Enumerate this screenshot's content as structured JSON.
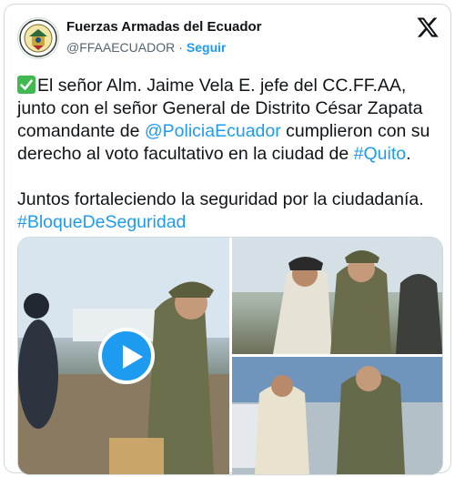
{
  "author": {
    "name": "Fuerzas Armadas del Ecuador",
    "handle": "@FFAAECUADOR",
    "separator": "·",
    "follow_label": "Seguir"
  },
  "tweet": {
    "line1_pre": "El señor Alm. Jaime Vela E. jefe del CC.FF.AA,",
    "line2": "junto con el señor General de Distrito César Zapata",
    "line3_pre": "comandante de ",
    "mention_policia": "@PoliciaEcuador",
    "line3_post": " cumplieron con su",
    "line4_pre": "derecho al voto facultativo en la ciudad de ",
    "hashtag_quito": "#Quito",
    "line4_post": ".",
    "line5": "Juntos fortaleciendo la seguridad por la ciudadanía.",
    "hashtag_bloque": "#BloqueDeSeguridad"
  },
  "media": {
    "items": [
      "video",
      "photo",
      "photo"
    ]
  },
  "icons": {
    "check": "white-heavy-check-mark-icon",
    "x_logo": "x-logo-icon",
    "play": "play-icon"
  },
  "colors": {
    "link": "#1d9bf0",
    "check_bg": "#3fb950",
    "text": "#0f1419",
    "muted": "#536471"
  }
}
